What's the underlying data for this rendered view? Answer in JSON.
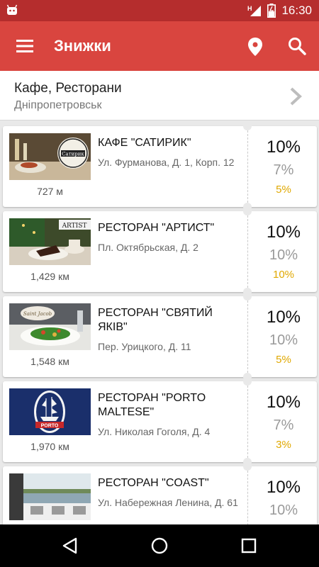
{
  "status_bar": {
    "time": "16:30",
    "network": "H"
  },
  "app_bar": {
    "title": "Знижки",
    "menu_icon": "hamburger-icon",
    "location_icon": "map-pin-icon",
    "search_icon": "search-icon"
  },
  "category": {
    "title": "Кафе, Ресторани",
    "city": "Дніпропетровськ"
  },
  "colors": {
    "primary": "#d9453f",
    "status_bar": "#b52d2d",
    "discount_gold": "#e0a800"
  },
  "places": [
    {
      "name": "КАФЕ \"САТИРИК\"",
      "address": "Ул. Фурманова, Д. 1, Корп. 12",
      "distance": "727 м",
      "discounts": [
        "10%",
        "7%",
        "5%"
      ],
      "logo_text": "Сатирик"
    },
    {
      "name": "РЕСТОРАН \"АРТИСТ\"",
      "address": "Пл. Октябрьская, Д. 2",
      "distance": "1,429 км",
      "discounts": [
        "10%",
        "10%",
        "10%"
      ],
      "logo_text": "ARTIST"
    },
    {
      "name": "РЕСТОРАН \"СВЯТИЙ ЯКІВ\"",
      "address": "Пер. Урицкого, Д. 11",
      "distance": "1,548 км",
      "discounts": [
        "10%",
        "10%",
        "5%"
      ],
      "logo_text": "Saint Jacob"
    },
    {
      "name": "РЕСТОРАН \"PORTO MALTESE\"",
      "address": "Ул. Николая Гоголя, Д. 4",
      "distance": "1,970 км",
      "discounts": [
        "10%",
        "7%",
        "3%"
      ],
      "logo_text": "PORTO"
    },
    {
      "name": "РЕСТОРАН \"COAST\"",
      "address": "Ул. Набережная Ленина, Д. 61",
      "distance": "",
      "discounts": [
        "10%",
        "10%",
        ""
      ],
      "logo_text": ""
    }
  ]
}
